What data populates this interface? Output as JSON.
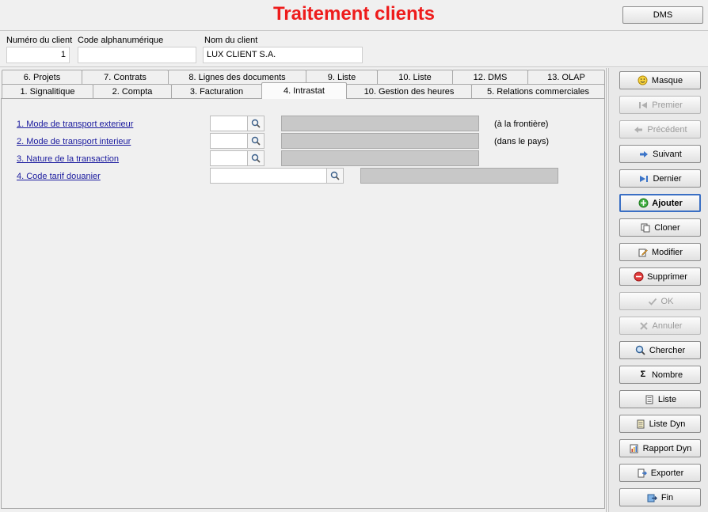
{
  "header": {
    "title": "Traitement clients",
    "dms_label": "DMS"
  },
  "client": {
    "numero_label": "Numéro du client",
    "numero_value": "1",
    "code_label": "Code alphanumérique",
    "code_value": "",
    "nom_label": "Nom du client",
    "nom_value": "LUX CLIENT S.A."
  },
  "tabs_row1": [
    "6. Projets",
    "7. Contrats",
    "8. Lignes des documents",
    "9. Liste",
    "10. Liste",
    "12. DMS",
    "13. OLAP"
  ],
  "tabs_row2": [
    "1. Signalitique",
    "2. Compta",
    "3. Facturation",
    "4. Intrastat",
    "10. Gestion des heures",
    "5. Relations commerciales"
  ],
  "active_tab": "4. Intrastat",
  "intrastat": {
    "rows": [
      {
        "label": "1. Mode de transport exterieur",
        "note": "(à la frontière)"
      },
      {
        "label": "2. Mode de transport interieur",
        "note": "(dans le pays)"
      },
      {
        "label": "3. Nature de la transaction",
        "note": ""
      },
      {
        "label": "4. Code tarif douanier",
        "note": ""
      }
    ]
  },
  "actions": [
    {
      "label": "Masque",
      "icon": "smiley-icon",
      "state": "enabled"
    },
    {
      "label": "Premier",
      "icon": "first-icon",
      "state": "disabled"
    },
    {
      "label": "Précédent",
      "icon": "previous-icon",
      "state": "disabled"
    },
    {
      "label": "Suivant",
      "icon": "next-icon",
      "state": "enabled"
    },
    {
      "label": "Dernier",
      "icon": "last-icon",
      "state": "enabled"
    },
    {
      "label": "Ajouter",
      "icon": "add-icon",
      "state": "focused"
    },
    {
      "label": "Cloner",
      "icon": "clone-icon",
      "state": "enabled"
    },
    {
      "label": "Modifier",
      "icon": "edit-icon",
      "state": "enabled"
    },
    {
      "label": "Supprimer",
      "icon": "delete-icon",
      "state": "enabled"
    },
    {
      "label": "OK",
      "icon": "check-icon",
      "state": "disabled"
    },
    {
      "label": "Annuler",
      "icon": "cancel-icon",
      "state": "disabled"
    },
    {
      "label": "Chercher",
      "icon": "search-icon",
      "state": "enabled"
    },
    {
      "label": "Nombre",
      "icon": "sigma-icon",
      "state": "enabled"
    },
    {
      "label": "Liste",
      "icon": "list-icon",
      "state": "enabled"
    },
    {
      "label": "Liste Dyn",
      "icon": "dyn-list-icon",
      "state": "enabled"
    },
    {
      "label": "Rapport Dyn",
      "icon": "report-icon",
      "state": "enabled"
    },
    {
      "label": "Exporter",
      "icon": "export-icon",
      "state": "enabled"
    },
    {
      "label": "Fin",
      "icon": "exit-icon",
      "state": "enabled"
    }
  ],
  "colors": {
    "title": "#ee1c1c",
    "link": "#1a1a9e",
    "background": "#f0f0f0"
  }
}
